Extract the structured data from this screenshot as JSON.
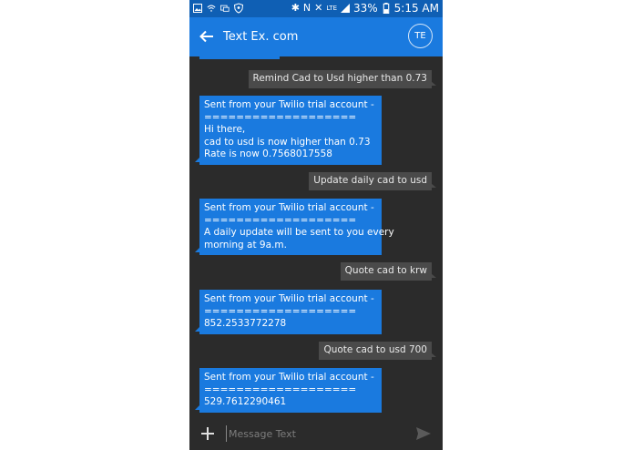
{
  "status_bar": {
    "battery_percent": "33%",
    "time": "5:15 AM",
    "network": "LTE"
  },
  "app_bar": {
    "title": "Text Ex. com",
    "avatar_initials": "TE"
  },
  "messages": [
    {
      "direction": "out",
      "lines": [
        "Remind Cad to Usd higher than 0.73"
      ]
    },
    {
      "direction": "in",
      "lines": [
        "Sent from your Twilio trial account -",
        "===================",
        "Hi there,",
        "cad to usd is now higher than 0.73",
        "Rate is now 0.7568017558"
      ]
    },
    {
      "direction": "out",
      "lines": [
        "Update daily cad to usd"
      ]
    },
    {
      "direction": "in",
      "lines": [
        "Sent from your Twilio trial account -",
        "===================",
        "A daily update will be sent to you every",
        "morning at 9a.m."
      ]
    },
    {
      "direction": "out",
      "lines": [
        "Quote cad to krw"
      ]
    },
    {
      "direction": "in",
      "lines": [
        "Sent from your Twilio trial account -",
        "===================",
        "852.2533772278"
      ]
    },
    {
      "direction": "out",
      "lines": [
        "Quote cad to usd 700"
      ]
    },
    {
      "direction": "in",
      "lines": [
        "Sent from your Twilio trial account -",
        "===================",
        "529.7612290461"
      ]
    }
  ],
  "compose": {
    "placeholder": "Message Text"
  },
  "colors": {
    "status_bar": "#0f5fb4",
    "app_bar": "#1a7adf",
    "background": "#2b2b2b",
    "incoming_bubble": "#1a7adf",
    "outgoing_bubble": "#4a4a4a"
  },
  "icons": {
    "back": "arrow-left-icon",
    "add": "plus-icon",
    "send": "send-icon"
  }
}
